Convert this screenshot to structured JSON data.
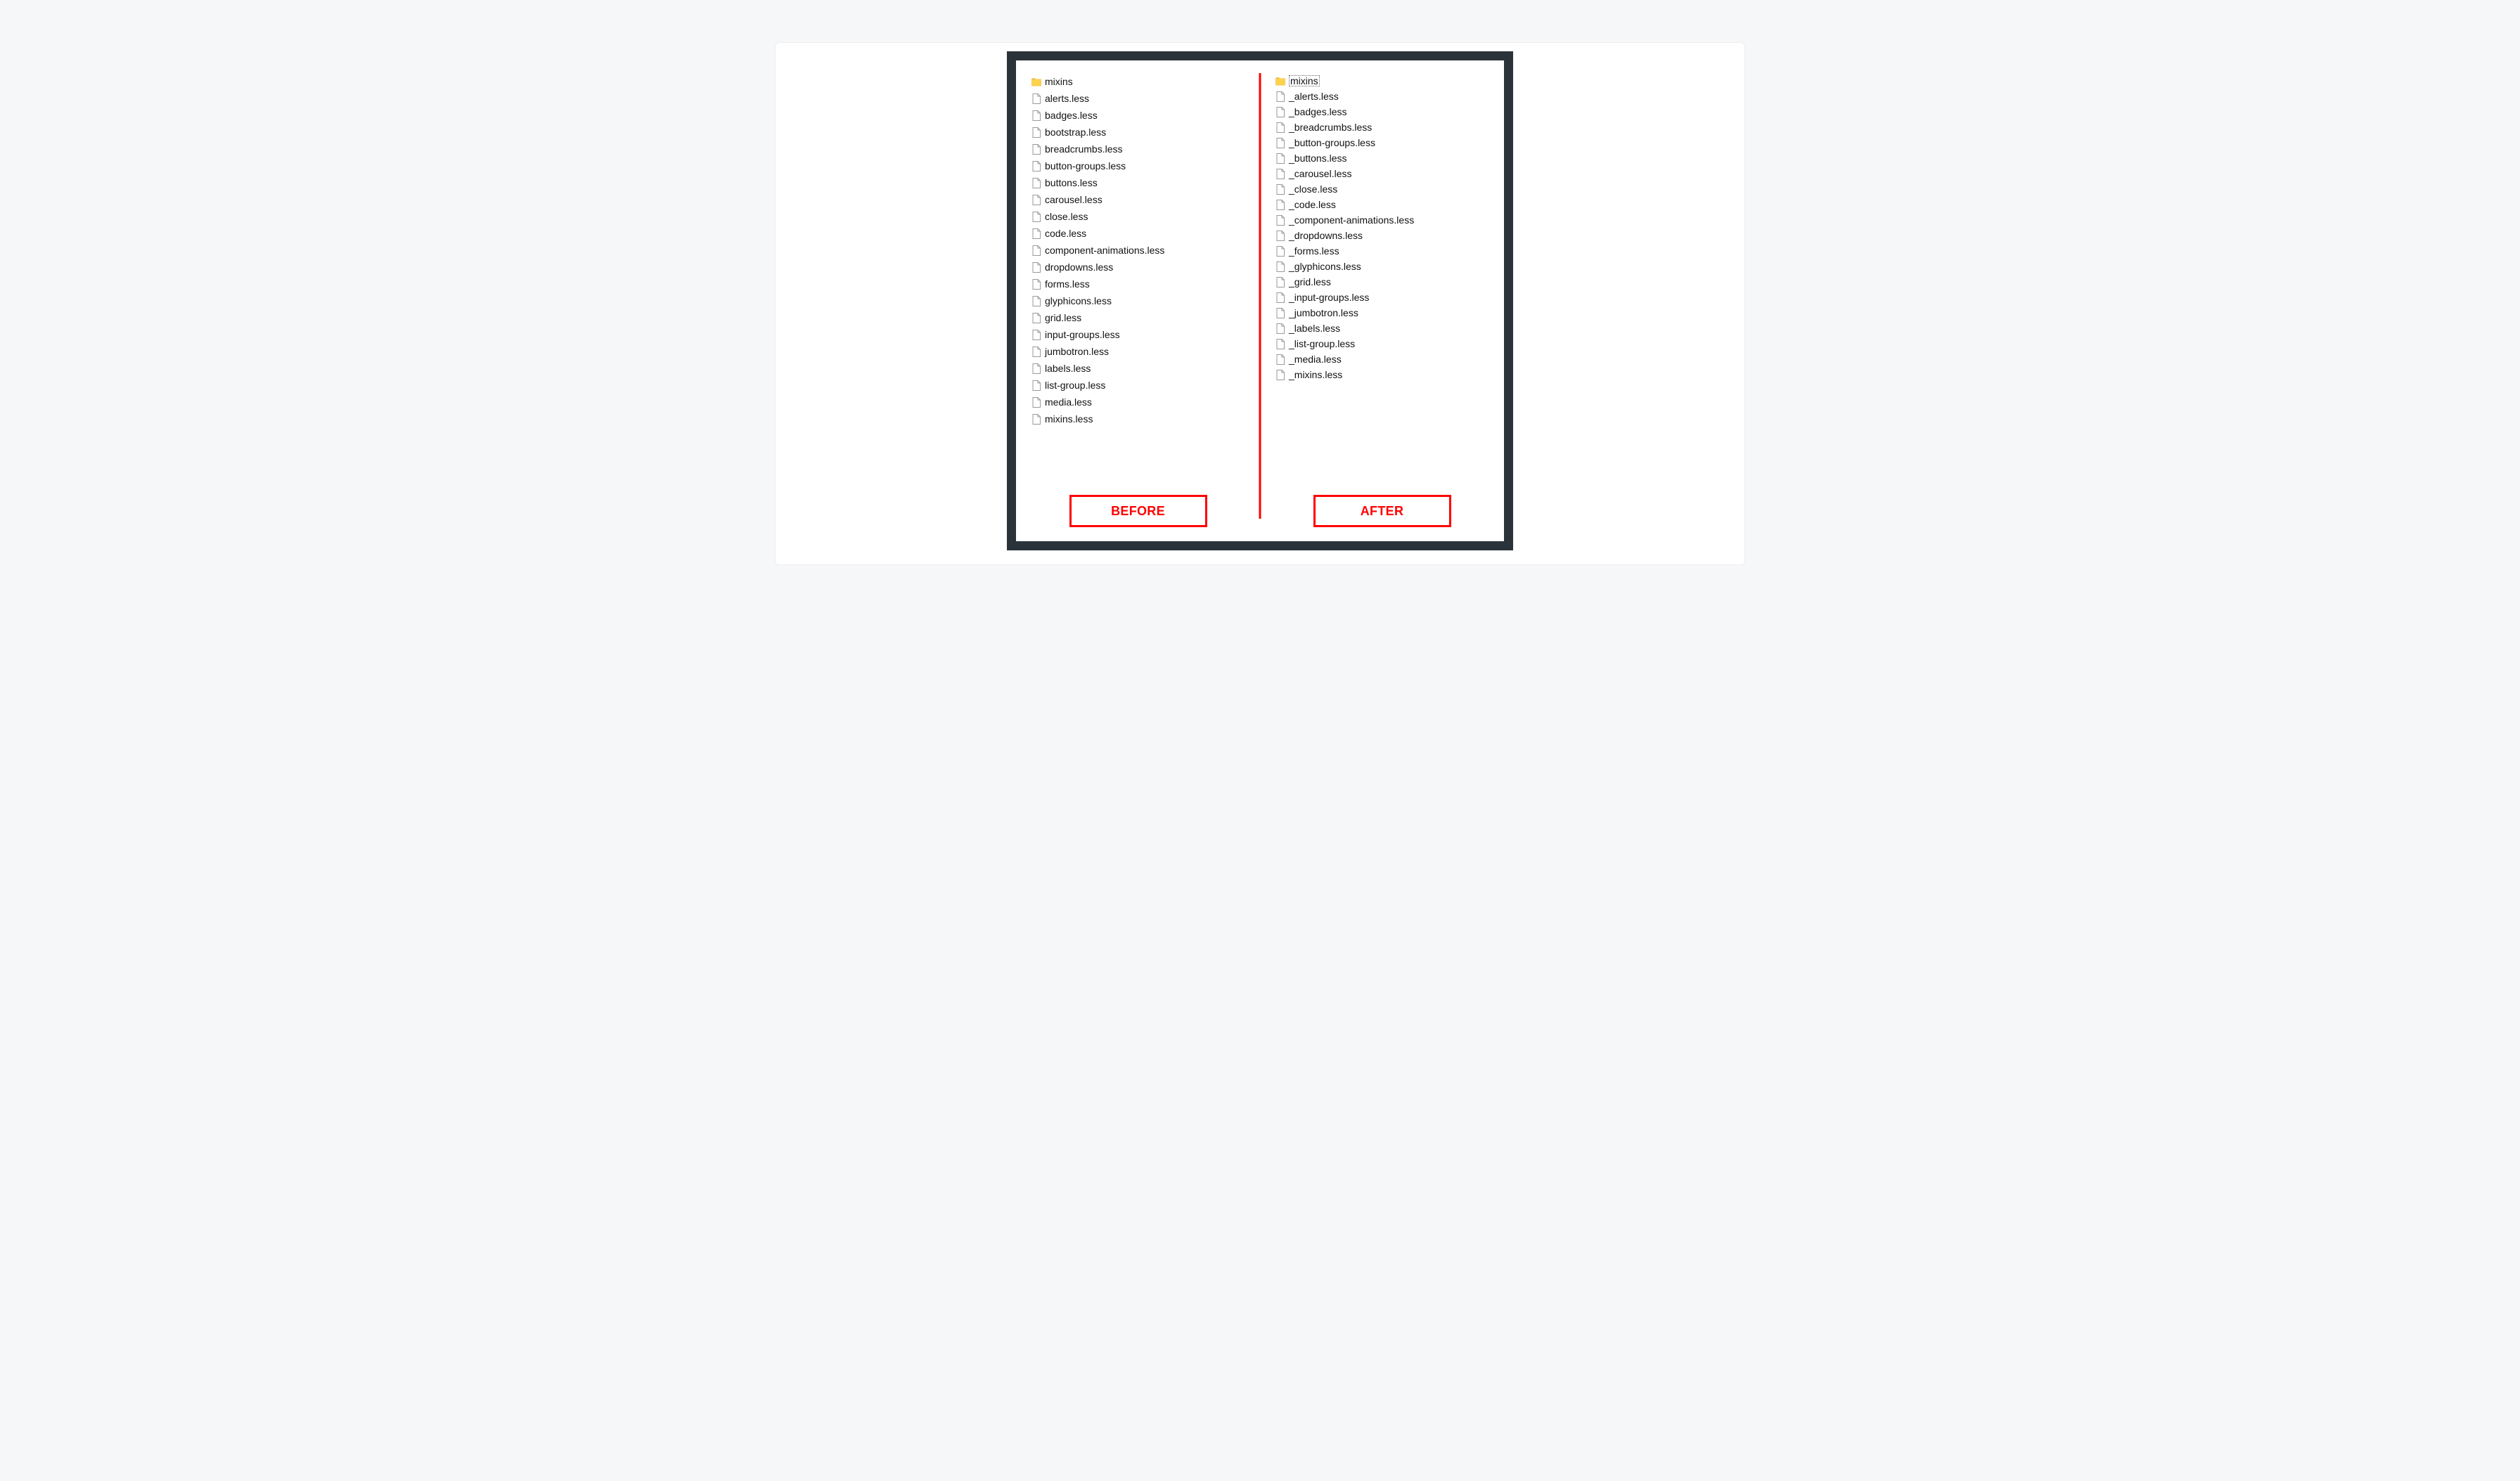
{
  "colors": {
    "frame": "#2b333a",
    "accent": "#ff0000",
    "folder": "#ffd24d",
    "folderShade": "#e8b83e",
    "fileStroke": "#9a9a9a"
  },
  "before": {
    "label": "BEFORE",
    "items": [
      {
        "name": "mixins",
        "type": "folder",
        "selected": false
      },
      {
        "name": "alerts.less",
        "type": "file"
      },
      {
        "name": "badges.less",
        "type": "file"
      },
      {
        "name": "bootstrap.less",
        "type": "file"
      },
      {
        "name": "breadcrumbs.less",
        "type": "file"
      },
      {
        "name": "button-groups.less",
        "type": "file"
      },
      {
        "name": "buttons.less",
        "type": "file"
      },
      {
        "name": "carousel.less",
        "type": "file"
      },
      {
        "name": "close.less",
        "type": "file"
      },
      {
        "name": "code.less",
        "type": "file"
      },
      {
        "name": "component-animations.less",
        "type": "file"
      },
      {
        "name": "dropdowns.less",
        "type": "file"
      },
      {
        "name": "forms.less",
        "type": "file"
      },
      {
        "name": "glyphicons.less",
        "type": "file"
      },
      {
        "name": "grid.less",
        "type": "file"
      },
      {
        "name": "input-groups.less",
        "type": "file"
      },
      {
        "name": "jumbotron.less",
        "type": "file"
      },
      {
        "name": "labels.less",
        "type": "file"
      },
      {
        "name": "list-group.less",
        "type": "file"
      },
      {
        "name": "media.less",
        "type": "file"
      },
      {
        "name": "mixins.less",
        "type": "file"
      }
    ]
  },
  "after": {
    "label": "AFTER",
    "items": [
      {
        "name": "mixins",
        "type": "folder",
        "selected": true
      },
      {
        "name": "_alerts.less",
        "type": "file"
      },
      {
        "name": "_badges.less",
        "type": "file"
      },
      {
        "name": "_breadcrumbs.less",
        "type": "file"
      },
      {
        "name": "_button-groups.less",
        "type": "file"
      },
      {
        "name": "_buttons.less",
        "type": "file"
      },
      {
        "name": "_carousel.less",
        "type": "file"
      },
      {
        "name": "_close.less",
        "type": "file"
      },
      {
        "name": "_code.less",
        "type": "file"
      },
      {
        "name": "_component-animations.less",
        "type": "file"
      },
      {
        "name": "_dropdowns.less",
        "type": "file"
      },
      {
        "name": "_forms.less",
        "type": "file"
      },
      {
        "name": "_glyphicons.less",
        "type": "file"
      },
      {
        "name": "_grid.less",
        "type": "file"
      },
      {
        "name": "_input-groups.less",
        "type": "file"
      },
      {
        "name": "_jumbotron.less",
        "type": "file"
      },
      {
        "name": "_labels.less",
        "type": "file"
      },
      {
        "name": "_list-group.less",
        "type": "file"
      },
      {
        "name": "_media.less",
        "type": "file"
      },
      {
        "name": "_mixins.less",
        "type": "file"
      }
    ]
  }
}
